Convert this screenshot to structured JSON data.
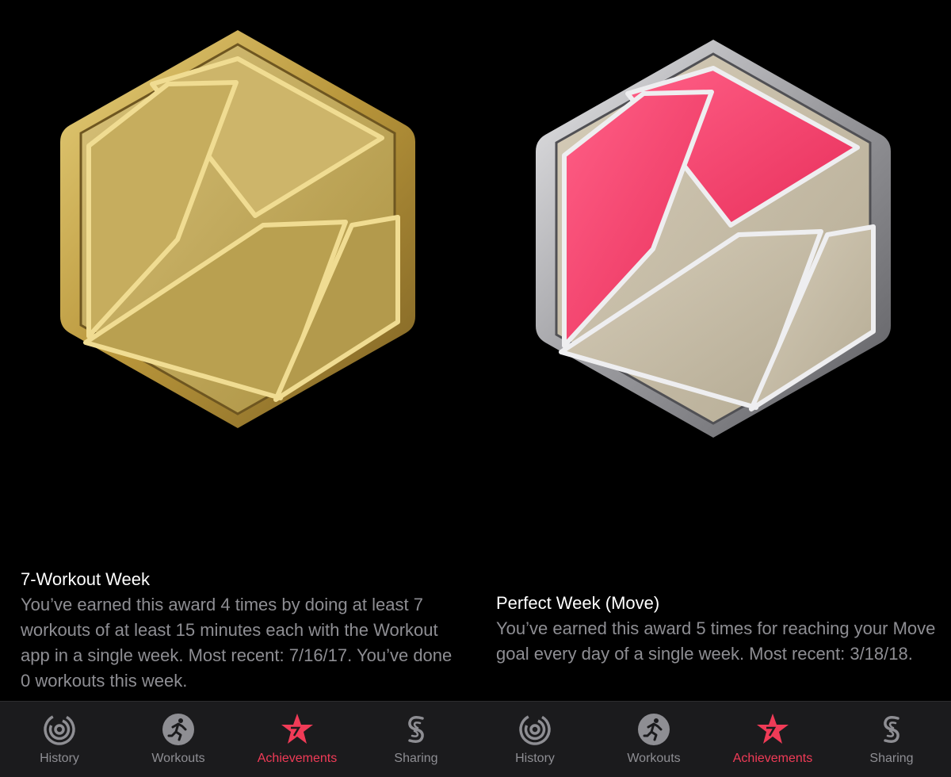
{
  "awards": [
    {
      "title": "7-Workout Week",
      "description": "You’ve earned this award 4 times by doing at least 7 workouts of at least 15 minutes each with the Workout app in a single week. Most recent: 7/16/17. You’ve done 0 workouts this week.",
      "badge_icon": "seven-workout-week-gold-badge-icon",
      "colors": {
        "frame": "#c9a84a",
        "upper": "#c6b062",
        "lower": "#bfa650"
      }
    },
    {
      "title": "Perfect Week (Move)",
      "description": "You’ve earned this award 5 times for reaching your Move goal every day of a single week. Most recent: 3/18/18.",
      "badge_icon": "perfect-week-move-silver-badge-icon",
      "colors": {
        "frame": "#a8a8ab",
        "upper": "#f5466f",
        "lower": "#c8bea8"
      }
    }
  ],
  "tabbar": {
    "groups": [
      {
        "tabs": [
          {
            "label": "History",
            "icon": "history-rings-icon",
            "active": false
          },
          {
            "label": "Workouts",
            "icon": "runner-icon",
            "active": false
          },
          {
            "label": "Achievements",
            "icon": "star-award-icon",
            "active": true
          },
          {
            "label": "Sharing",
            "icon": "sharing-s-icon",
            "active": false
          }
        ]
      },
      {
        "tabs": [
          {
            "label": "History",
            "icon": "history-rings-icon",
            "active": false
          },
          {
            "label": "Workouts",
            "icon": "runner-icon",
            "active": false
          },
          {
            "label": "Achievements",
            "icon": "star-award-icon",
            "active": true
          },
          {
            "label": "Sharing",
            "icon": "sharing-s-icon",
            "active": false
          }
        ]
      }
    ],
    "active_color": "#f03b57",
    "inactive_color": "#8e8e93"
  }
}
